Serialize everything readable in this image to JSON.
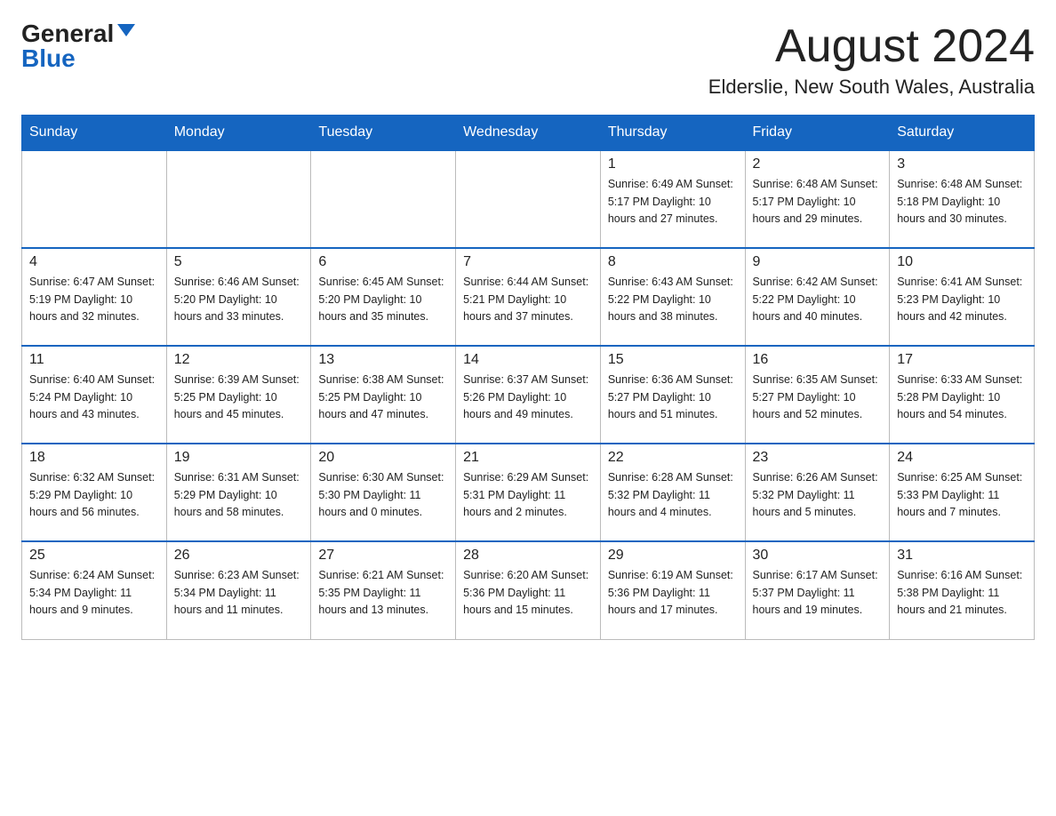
{
  "header": {
    "logo_general": "General",
    "logo_blue": "Blue",
    "month_title": "August 2024",
    "location": "Elderslie, New South Wales, Australia"
  },
  "days_of_week": [
    "Sunday",
    "Monday",
    "Tuesday",
    "Wednesday",
    "Thursday",
    "Friday",
    "Saturday"
  ],
  "weeks": [
    [
      {
        "day": "",
        "info": ""
      },
      {
        "day": "",
        "info": ""
      },
      {
        "day": "",
        "info": ""
      },
      {
        "day": "",
        "info": ""
      },
      {
        "day": "1",
        "info": "Sunrise: 6:49 AM\nSunset: 5:17 PM\nDaylight: 10 hours\nand 27 minutes."
      },
      {
        "day": "2",
        "info": "Sunrise: 6:48 AM\nSunset: 5:17 PM\nDaylight: 10 hours\nand 29 minutes."
      },
      {
        "day": "3",
        "info": "Sunrise: 6:48 AM\nSunset: 5:18 PM\nDaylight: 10 hours\nand 30 minutes."
      }
    ],
    [
      {
        "day": "4",
        "info": "Sunrise: 6:47 AM\nSunset: 5:19 PM\nDaylight: 10 hours\nand 32 minutes."
      },
      {
        "day": "5",
        "info": "Sunrise: 6:46 AM\nSunset: 5:20 PM\nDaylight: 10 hours\nand 33 minutes."
      },
      {
        "day": "6",
        "info": "Sunrise: 6:45 AM\nSunset: 5:20 PM\nDaylight: 10 hours\nand 35 minutes."
      },
      {
        "day": "7",
        "info": "Sunrise: 6:44 AM\nSunset: 5:21 PM\nDaylight: 10 hours\nand 37 minutes."
      },
      {
        "day": "8",
        "info": "Sunrise: 6:43 AM\nSunset: 5:22 PM\nDaylight: 10 hours\nand 38 minutes."
      },
      {
        "day": "9",
        "info": "Sunrise: 6:42 AM\nSunset: 5:22 PM\nDaylight: 10 hours\nand 40 minutes."
      },
      {
        "day": "10",
        "info": "Sunrise: 6:41 AM\nSunset: 5:23 PM\nDaylight: 10 hours\nand 42 minutes."
      }
    ],
    [
      {
        "day": "11",
        "info": "Sunrise: 6:40 AM\nSunset: 5:24 PM\nDaylight: 10 hours\nand 43 minutes."
      },
      {
        "day": "12",
        "info": "Sunrise: 6:39 AM\nSunset: 5:25 PM\nDaylight: 10 hours\nand 45 minutes."
      },
      {
        "day": "13",
        "info": "Sunrise: 6:38 AM\nSunset: 5:25 PM\nDaylight: 10 hours\nand 47 minutes."
      },
      {
        "day": "14",
        "info": "Sunrise: 6:37 AM\nSunset: 5:26 PM\nDaylight: 10 hours\nand 49 minutes."
      },
      {
        "day": "15",
        "info": "Sunrise: 6:36 AM\nSunset: 5:27 PM\nDaylight: 10 hours\nand 51 minutes."
      },
      {
        "day": "16",
        "info": "Sunrise: 6:35 AM\nSunset: 5:27 PM\nDaylight: 10 hours\nand 52 minutes."
      },
      {
        "day": "17",
        "info": "Sunrise: 6:33 AM\nSunset: 5:28 PM\nDaylight: 10 hours\nand 54 minutes."
      }
    ],
    [
      {
        "day": "18",
        "info": "Sunrise: 6:32 AM\nSunset: 5:29 PM\nDaylight: 10 hours\nand 56 minutes."
      },
      {
        "day": "19",
        "info": "Sunrise: 6:31 AM\nSunset: 5:29 PM\nDaylight: 10 hours\nand 58 minutes."
      },
      {
        "day": "20",
        "info": "Sunrise: 6:30 AM\nSunset: 5:30 PM\nDaylight: 11 hours\nand 0 minutes."
      },
      {
        "day": "21",
        "info": "Sunrise: 6:29 AM\nSunset: 5:31 PM\nDaylight: 11 hours\nand 2 minutes."
      },
      {
        "day": "22",
        "info": "Sunrise: 6:28 AM\nSunset: 5:32 PM\nDaylight: 11 hours\nand 4 minutes."
      },
      {
        "day": "23",
        "info": "Sunrise: 6:26 AM\nSunset: 5:32 PM\nDaylight: 11 hours\nand 5 minutes."
      },
      {
        "day": "24",
        "info": "Sunrise: 6:25 AM\nSunset: 5:33 PM\nDaylight: 11 hours\nand 7 minutes."
      }
    ],
    [
      {
        "day": "25",
        "info": "Sunrise: 6:24 AM\nSunset: 5:34 PM\nDaylight: 11 hours\nand 9 minutes."
      },
      {
        "day": "26",
        "info": "Sunrise: 6:23 AM\nSunset: 5:34 PM\nDaylight: 11 hours\nand 11 minutes."
      },
      {
        "day": "27",
        "info": "Sunrise: 6:21 AM\nSunset: 5:35 PM\nDaylight: 11 hours\nand 13 minutes."
      },
      {
        "day": "28",
        "info": "Sunrise: 6:20 AM\nSunset: 5:36 PM\nDaylight: 11 hours\nand 15 minutes."
      },
      {
        "day": "29",
        "info": "Sunrise: 6:19 AM\nSunset: 5:36 PM\nDaylight: 11 hours\nand 17 minutes."
      },
      {
        "day": "30",
        "info": "Sunrise: 6:17 AM\nSunset: 5:37 PM\nDaylight: 11 hours\nand 19 minutes."
      },
      {
        "day": "31",
        "info": "Sunrise: 6:16 AM\nSunset: 5:38 PM\nDaylight: 11 hours\nand 21 minutes."
      }
    ]
  ]
}
